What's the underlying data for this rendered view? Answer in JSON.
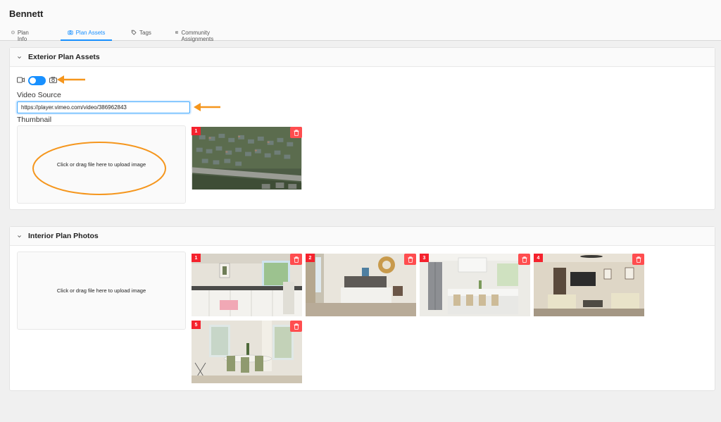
{
  "page": {
    "title": "Bennett"
  },
  "tabs": [
    {
      "label": "Plan Info",
      "icon": "info-icon",
      "active": false
    },
    {
      "label": "Plan Assets",
      "icon": "camera-icon",
      "active": true
    },
    {
      "label": "Tags",
      "icon": "tag-icon",
      "active": false
    },
    {
      "label": "Community Assignments",
      "icon": "table-icon",
      "active": false
    }
  ],
  "exterior": {
    "title": "Exterior Plan Assets",
    "toggle": {
      "left_icon": "video-icon",
      "right_icon": "camera-icon",
      "on": true
    },
    "video_source_label": "Video Source",
    "video_url": "https://player.vimeo.com/video/386962843",
    "thumbnail_label": "Thumbnail",
    "upload_text": "Click or drag file here to upload image",
    "images": [
      {
        "index": "1",
        "subject": "aerial-neighborhood-photo"
      }
    ]
  },
  "interior": {
    "title": "Interior Plan Photos",
    "upload_text": "Click or drag file here to upload image",
    "images": [
      {
        "index": "1",
        "subject": "kitchen-photo"
      },
      {
        "index": "2",
        "subject": "bedroom-photo"
      },
      {
        "index": "3",
        "subject": "kitchen-island-photo"
      },
      {
        "index": "4",
        "subject": "living-room-photo"
      },
      {
        "index": "5",
        "subject": "dining-room-photo"
      }
    ]
  },
  "colors": {
    "accent": "#1890ff",
    "delete": "#ff4d4f",
    "badge": "#f5222d",
    "annotation": "#f5961d"
  }
}
